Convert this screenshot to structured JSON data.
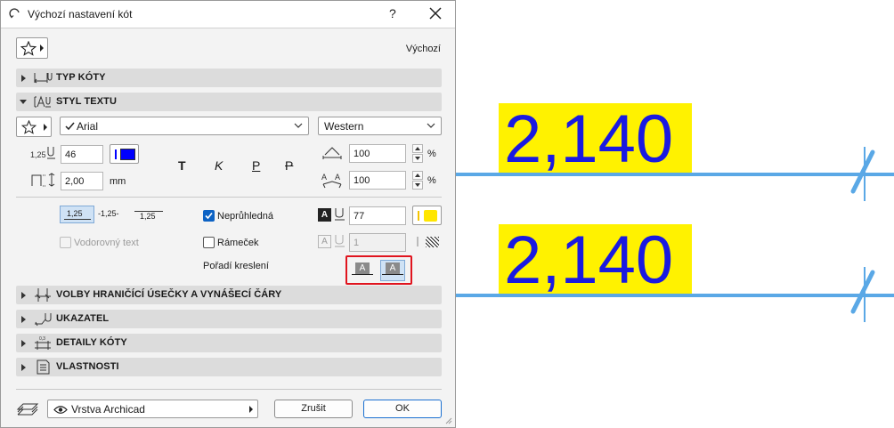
{
  "window": {
    "title": "Výchozí nastavení kót",
    "help": "?",
    "close": "✕"
  },
  "header": {
    "default_label": "Výchozí"
  },
  "sections": {
    "typ_koty": "TYP KÓTY",
    "styl_textu": "STYL TEXTU",
    "volby": "VOLBY HRANIČÍCÍ ÚSEČKY A VYNÁŠECÍ ČÁRY",
    "ukazatel": "UKAZATEL",
    "detaily": "DETAILY KÓTY",
    "vlastnosti": "VLASTNOSTI"
  },
  "text_style": {
    "font": "Arial",
    "script": "Western",
    "size": "46",
    "spacing": "2,00",
    "spacing_unit": "mm",
    "width_pct": "100",
    "spacing_pct": "100",
    "pct_unit": "%",
    "pen_color": "#0000ff",
    "style_buttons": [
      "T",
      "K",
      "P",
      "P"
    ]
  },
  "placement": {
    "options": [
      "1,25",
      "-1,25-",
      "1,25"
    ],
    "opaque_label": "Neprůhledná",
    "opaque_checked": true,
    "horizontal_label": "Vodorovný text",
    "horizontal_checked": false,
    "frame_label": "Rámeček",
    "frame_checked": false,
    "draw_order_label": "Pořadí kreslení",
    "fill_pen": "77",
    "fill_color": "#ffe600",
    "frame_pen": "1"
  },
  "footer": {
    "layer": "Vrstva Archicad",
    "cancel": "Zrušit",
    "ok": "OK"
  },
  "preview": {
    "label_top": "2,140",
    "label_bottom": "2,140",
    "text_color": "#1a1ae0",
    "bg_color": "#fff200",
    "line_color": "#5aa8e6"
  }
}
